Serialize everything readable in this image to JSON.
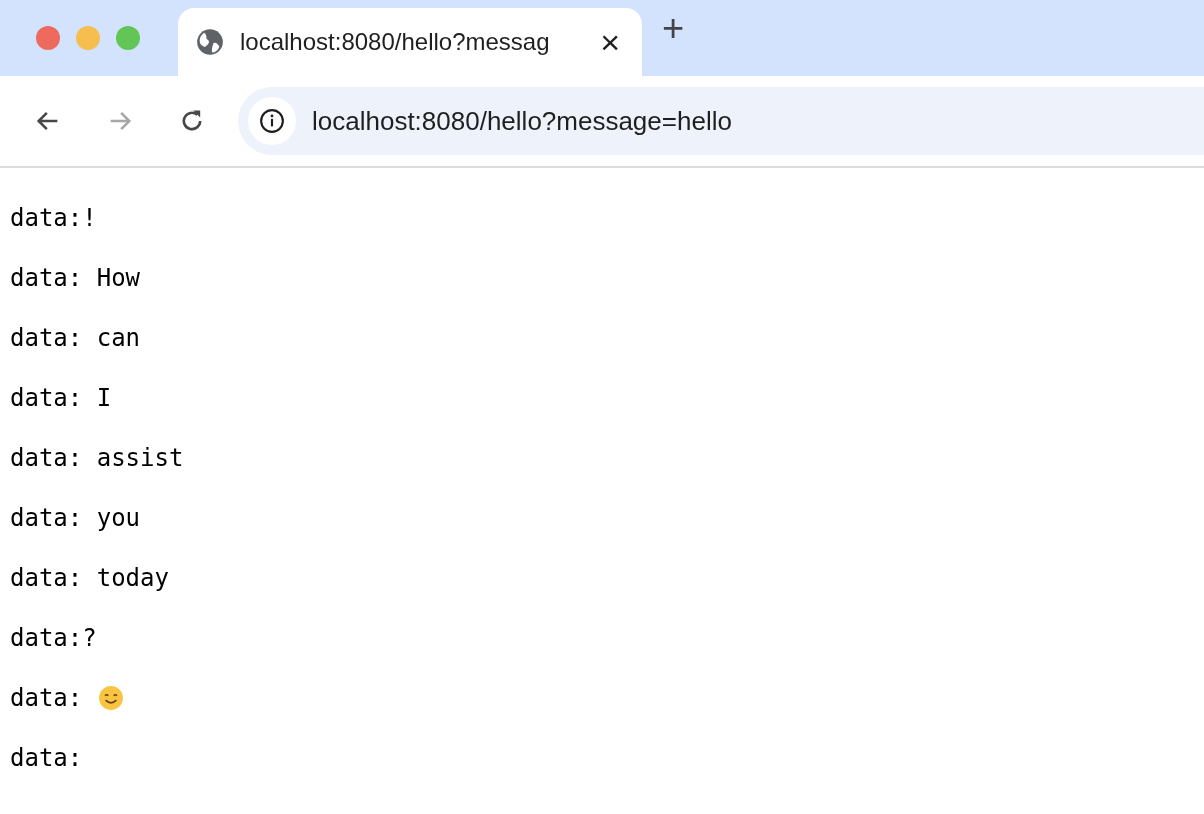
{
  "tab": {
    "title": "localhost:8080/hello?messag",
    "close": "×"
  },
  "new_tab": "+",
  "nav_buttons": [
    {
      "kind": "back",
      "disabled": false
    },
    {
      "kind": "forward",
      "disabled": true
    },
    {
      "kind": "reload",
      "disabled": false
    }
  ],
  "address_bar": {
    "value": "localhost:8080/hello?message=hello"
  },
  "lines": [
    {
      "kind": "text",
      "text": "data:!"
    },
    {
      "kind": "text",
      "text": "data: How"
    },
    {
      "kind": "text",
      "text": "data: can"
    },
    {
      "kind": "text",
      "text": "data: I"
    },
    {
      "kind": "text",
      "text": "data: assist"
    },
    {
      "kind": "text",
      "text": "data: you"
    },
    {
      "kind": "text",
      "text": "data: today"
    },
    {
      "kind": "text",
      "text": "data:?"
    },
    {
      "kind": "emoji",
      "text": "data:"
    },
    {
      "kind": "text",
      "text": "data:"
    }
  ]
}
